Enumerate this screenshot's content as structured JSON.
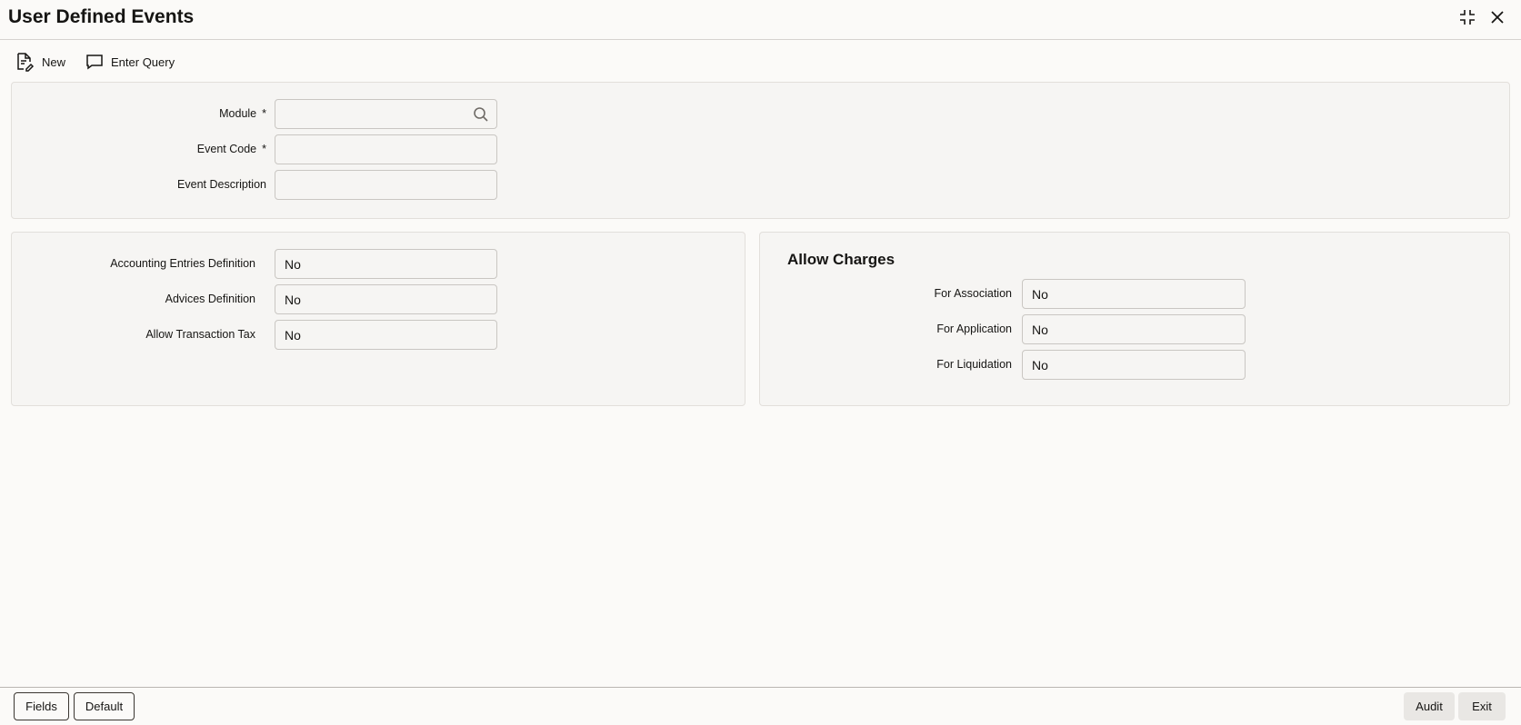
{
  "window": {
    "title": "User Defined Events",
    "icons": [
      "minimize-icon",
      "close-icon"
    ]
  },
  "toolbar": {
    "new_label": "New",
    "enter_query_label": "Enter Query"
  },
  "header_form": {
    "module_label": "Module",
    "module_value": "",
    "event_code_label": "Event Code",
    "event_code_value": "",
    "event_description_label": "Event Description",
    "event_description_value": "",
    "required_mark": "*"
  },
  "definitions": {
    "accounting_entries_label": "Accounting Entries Definition",
    "accounting_entries_value": "No",
    "advices_label": "Advices Definition",
    "advices_value": "No",
    "transaction_tax_label": "Allow Transaction Tax",
    "transaction_tax_value": "No"
  },
  "charges": {
    "title": "Allow Charges",
    "association_label": "For Association",
    "association_value": "No",
    "application_label": "For Application",
    "application_value": "No",
    "liquidation_label": "For Liquidation",
    "liquidation_value": "No"
  },
  "footer": {
    "fields_label": "Fields",
    "default_label": "Default",
    "audit_label": "Audit",
    "exit_label": "Exit"
  }
}
